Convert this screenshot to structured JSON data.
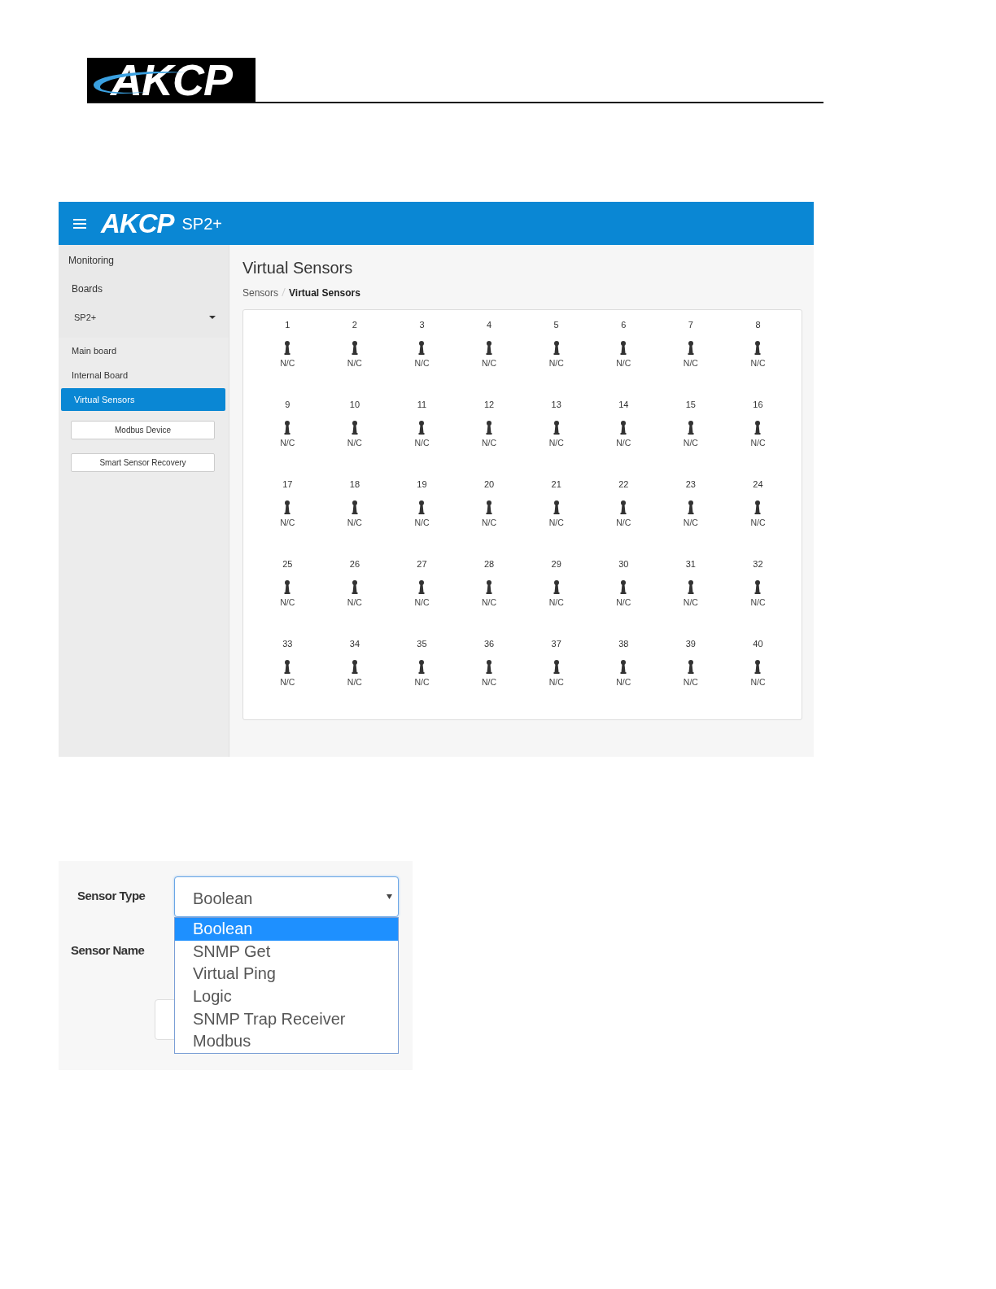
{
  "doc_header": {
    "logo": "AKCP"
  },
  "app": {
    "navbar": {
      "logo": "AKCP",
      "product": "SP2+"
    },
    "sidebar": {
      "items": [
        {
          "label": "Monitoring",
          "kind": "link",
          "selected": false
        },
        {
          "label": "Boards",
          "kind": "link",
          "selected": false
        },
        {
          "label": "SP2+",
          "kind": "dropdown",
          "selected": false
        },
        {
          "label": "Main board",
          "kind": "link",
          "selected": false
        },
        {
          "label": "Internal Board",
          "kind": "link",
          "selected": false
        },
        {
          "label": "Virtual Sensors",
          "kind": "link",
          "selected": true
        },
        {
          "label": "Modbus Device",
          "kind": "button"
        },
        {
          "label": "Smart Sensor Recovery",
          "kind": "button"
        }
      ]
    },
    "title": "Virtual Sensors",
    "breadcrumb": [
      "Sensors",
      "Virtual Sensors"
    ],
    "sensors": [
      {
        "number": "1",
        "status": "N/C"
      },
      {
        "number": "2",
        "status": "N/C"
      },
      {
        "number": "3",
        "status": "N/C"
      },
      {
        "number": "4",
        "status": "N/C"
      },
      {
        "number": "5",
        "status": "N/C"
      },
      {
        "number": "6",
        "status": "N/C"
      },
      {
        "number": "7",
        "status": "N/C"
      },
      {
        "number": "8",
        "status": "N/C"
      },
      {
        "number": "9",
        "status": "N/C"
      },
      {
        "number": "10",
        "status": "N/C"
      },
      {
        "number": "11",
        "status": "N/C"
      },
      {
        "number": "12",
        "status": "N/C"
      },
      {
        "number": "13",
        "status": "N/C"
      },
      {
        "number": "14",
        "status": "N/C"
      },
      {
        "number": "15",
        "status": "N/C"
      },
      {
        "number": "16",
        "status": "N/C"
      },
      {
        "number": "17",
        "status": "N/C"
      },
      {
        "number": "18",
        "status": "N/C"
      },
      {
        "number": "19",
        "status": "N/C"
      },
      {
        "number": "20",
        "status": "N/C"
      },
      {
        "number": "21",
        "status": "N/C"
      },
      {
        "number": "22",
        "status": "N/C"
      },
      {
        "number": "23",
        "status": "N/C"
      },
      {
        "number": "24",
        "status": "N/C"
      },
      {
        "number": "25",
        "status": "N/C"
      },
      {
        "number": "26",
        "status": "N/C"
      },
      {
        "number": "27",
        "status": "N/C"
      },
      {
        "number": "28",
        "status": "N/C"
      },
      {
        "number": "29",
        "status": "N/C"
      },
      {
        "number": "30",
        "status": "N/C"
      },
      {
        "number": "31",
        "status": "N/C"
      },
      {
        "number": "32",
        "status": "N/C"
      },
      {
        "number": "33",
        "status": "N/C"
      },
      {
        "number": "34",
        "status": "N/C"
      },
      {
        "number": "35",
        "status": "N/C"
      },
      {
        "number": "36",
        "status": "N/C"
      },
      {
        "number": "37",
        "status": "N/C"
      },
      {
        "number": "38",
        "status": "N/C"
      },
      {
        "number": "39",
        "status": "N/C"
      },
      {
        "number": "40",
        "status": "N/C"
      }
    ]
  },
  "form": {
    "sensor_type_label": "Sensor Type",
    "sensor_name_label": "Sensor Name",
    "sensor_type_value": "Boolean",
    "options": [
      {
        "label": "Boolean",
        "selected": true
      },
      {
        "label": "SNMP Get",
        "selected": false
      },
      {
        "label": "Virtual Ping",
        "selected": false
      },
      {
        "label": "Logic",
        "selected": false
      },
      {
        "label": "SNMP Trap Receiver",
        "selected": false
      },
      {
        "label": "Modbus",
        "selected": false
      }
    ]
  }
}
